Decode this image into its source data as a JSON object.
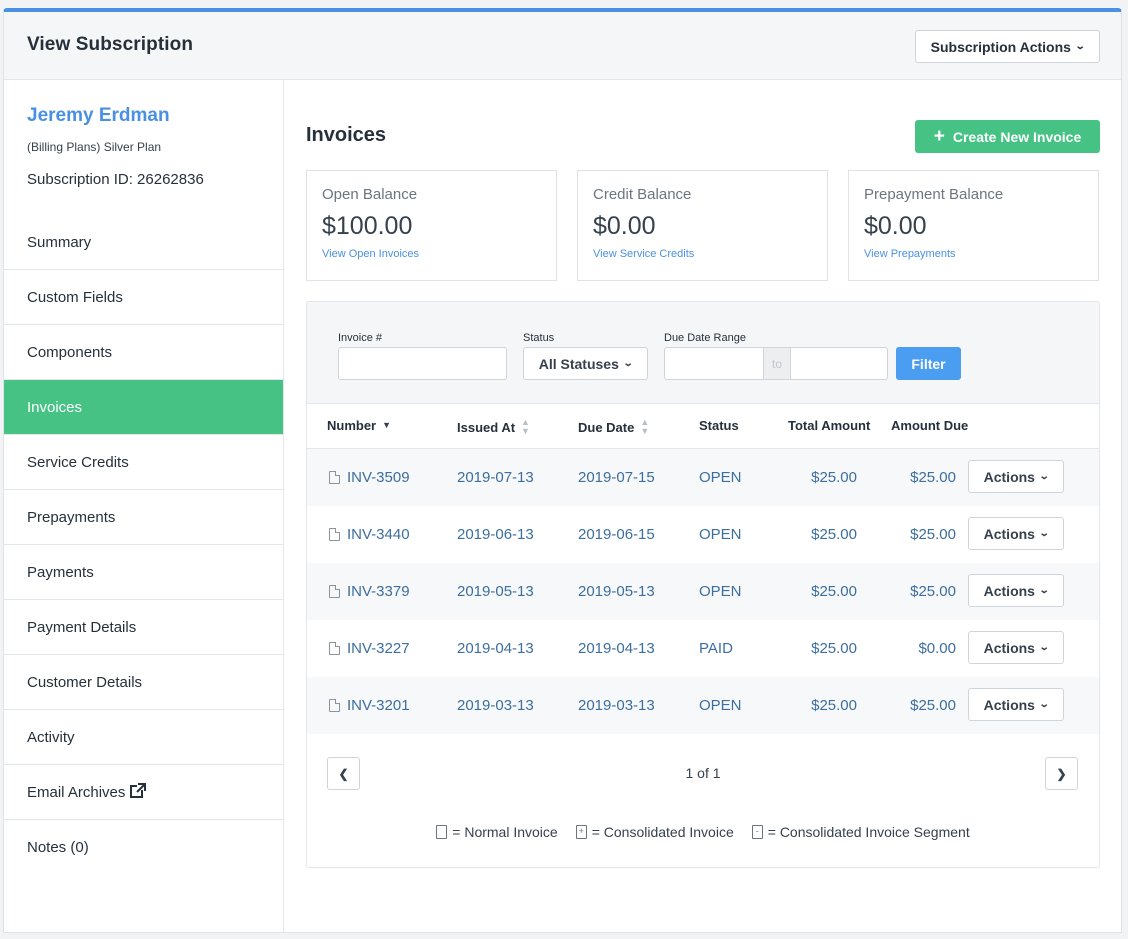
{
  "header": {
    "title": "View Subscription",
    "actions_label": "Subscription Actions"
  },
  "customer": {
    "name": "Jeremy Erdman",
    "plan": "(Billing Plans) Silver Plan",
    "subscription_id": "Subscription ID: 26262836"
  },
  "sidebar": {
    "items": [
      {
        "label": "Summary",
        "active": false
      },
      {
        "label": "Custom Fields",
        "active": false
      },
      {
        "label": "Components",
        "active": false
      },
      {
        "label": "Invoices",
        "active": true
      },
      {
        "label": "Service Credits",
        "active": false
      },
      {
        "label": "Prepayments",
        "active": false
      },
      {
        "label": "Payments",
        "active": false
      },
      {
        "label": "Payment Details",
        "active": false
      },
      {
        "label": "Customer Details",
        "active": false
      },
      {
        "label": "Activity",
        "active": false
      },
      {
        "label": "Email Archives",
        "active": false,
        "icon": "external-link-icon"
      },
      {
        "label": "Notes (0)",
        "active": false
      }
    ]
  },
  "invoices": {
    "title": "Invoices",
    "create_label": "Create New Invoice",
    "balances": [
      {
        "label": "Open Balance",
        "amount": "$100.00",
        "link": "View Open Invoices"
      },
      {
        "label": "Credit Balance",
        "amount": "$0.00",
        "link": "View Service Credits"
      },
      {
        "label": "Prepayment Balance",
        "amount": "$0.00",
        "link": "View Prepayments"
      }
    ],
    "filters": {
      "invoice_label": "Invoice #",
      "status_label": "Status",
      "status_value": "All Statuses",
      "date_label": "Due Date Range",
      "to_label": "to",
      "filter_button": "Filter"
    },
    "columns": [
      "Number",
      "Issued At",
      "Due Date",
      "Status",
      "Total Amount",
      "Amount Due"
    ],
    "rows": [
      {
        "number": "INV-3509",
        "issued": "2019-07-13",
        "due": "2019-07-15",
        "status": "OPEN",
        "total": "$25.00",
        "amount_due": "$25.00",
        "action": "Actions"
      },
      {
        "number": "INV-3440",
        "issued": "2019-06-13",
        "due": "2019-06-15",
        "status": "OPEN",
        "total": "$25.00",
        "amount_due": "$25.00",
        "action": "Actions"
      },
      {
        "number": "INV-3379",
        "issued": "2019-05-13",
        "due": "2019-05-13",
        "status": "OPEN",
        "total": "$25.00",
        "amount_due": "$25.00",
        "action": "Actions"
      },
      {
        "number": "INV-3227",
        "issued": "2019-04-13",
        "due": "2019-04-13",
        "status": "PAID",
        "total": "$25.00",
        "amount_due": "$0.00",
        "action": "Actions"
      },
      {
        "number": "INV-3201",
        "issued": "2019-03-13",
        "due": "2019-03-13",
        "status": "OPEN",
        "total": "$25.00",
        "amount_due": "$25.00",
        "action": "Actions"
      }
    ],
    "pagination": "1 of 1",
    "legend": [
      {
        "label": "= Normal Invoice",
        "icon": "normal-invoice-icon"
      },
      {
        "label": "= Consolidated Invoice",
        "icon": "consolidated-invoice-icon"
      },
      {
        "label": "= Consolidated Invoice Segment",
        "icon": "consolidated-segment-icon"
      }
    ]
  },
  "colors": {
    "accent_blue": "#4a90e2",
    "accent_green": "#46c384"
  }
}
